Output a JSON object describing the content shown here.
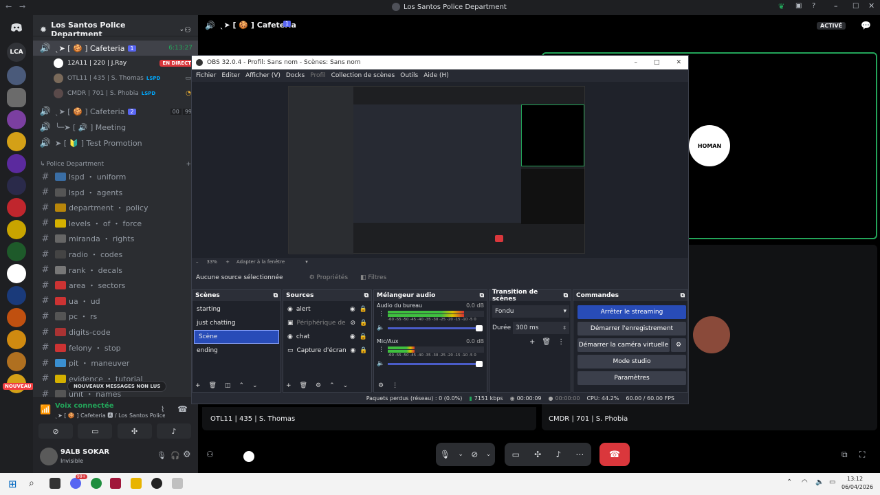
{
  "window": {
    "title": "Los Santos Police Department"
  },
  "server": {
    "name": "Los Santos Police Department"
  },
  "guild_label": "LCA",
  "guild_badge": "NOUVEAU",
  "voice_channels": [
    {
      "name": "ˎ➤ [ 🍪 ] Cafeteria",
      "badge": "1",
      "time": "6:13:27"
    },
    {
      "name": "ˎ➤ [ 🍪 ] Cafeteria",
      "badge": "2",
      "count_a": "00",
      "count_b": "99"
    },
    {
      "name": "╰─➤ [ 🔊 ] Meeting"
    },
    {
      "name": "➤ [ 🔰 ] Test Promotion"
    }
  ],
  "voice_members": [
    {
      "name": "12A11 | 220 | J.Ray",
      "tag": "EN DIRECT"
    },
    {
      "name": "OTL11 | 435 | S. Thomas",
      "tag": "LSPD"
    },
    {
      "name": "CMDR | 701 | S. Phobia",
      "tag": "LSPD"
    }
  ],
  "category": "Police Department",
  "text_channels": [
    "lspd ・ uniform",
    "lspd ・ agents",
    "department ・ policy",
    "levels ・ of ・ force",
    "miranda ・ rights",
    "radio ・ codes",
    "rank ・ decals",
    "area ・ sectors",
    "ua ・ ud",
    "pc ・ rs",
    "digits-code",
    "felony ・ stop",
    "pit ・ maneuver",
    "evidence ・ tutorial",
    "unit ・ names"
  ],
  "new_messages": "NOUVEAUX MESSAGES NON LUS",
  "voice_status": {
    "title": "Voix connectée",
    "subtitle": "ˎ➤ [ 🍪 ] Cafeteria 🅰 / Los Santos Police Depart..."
  },
  "user": {
    "name": "9ALB SOKAR",
    "status": "Invisible"
  },
  "call": {
    "channel": "ˎ➤ [ 🍪 ] Cafeteria",
    "badge": "1",
    "active": "ACTIVÉ",
    "tile_left": "OTL11 | 435 | S. Thomas",
    "tile_right": "CMDR | 701 | S. Phobia",
    "logo": "HOMAN"
  },
  "obs": {
    "title": "OBS 32.0.4 - Profil: Sans nom - Scènes: Sans nom",
    "menu": [
      "Fichier",
      "Editer",
      "Afficher (V)",
      "Docks",
      "Profil",
      "Collection de scènes",
      "Outils",
      "Aide (H)"
    ],
    "zoom": "33%",
    "fit": "Adapter à la fenêtre",
    "no_source": "Aucune source sélectionnée",
    "properties": "Propriétés",
    "filters": "Filtres",
    "scenes_header": "Scènes",
    "scenes": [
      "starting",
      "just chatting",
      "Scène",
      "ending"
    ],
    "sources_header": "Sources",
    "sources": [
      "alert",
      "Périphérique de c",
      "chat",
      "Capture d'écran"
    ],
    "mixer_header": "Mélangeur audio",
    "mixer": [
      {
        "name": "Audio du bureau",
        "db": "0.0 dB",
        "level": 0.85
      },
      {
        "name": "Mic/Aux",
        "db": "0.0 dB",
        "level": 0.3
      }
    ],
    "scale": "-60 -55 -50 -45 -40 -35 -30 -25 -20 -15 -10 -5 0",
    "transition_header": "Transition de scènes",
    "transition": "Fondu",
    "duration_label": "Durée",
    "duration": "300 ms",
    "commands_header": "Commandes",
    "commands": [
      "Arrêter le streaming",
      "Démarrer l'enregistrement",
      "Démarrer la caméra virtuelle",
      "Mode studio",
      "Paramètres"
    ],
    "status": {
      "dropped": "Paquets perdus (réseau) : 0 (0.0%)",
      "kbps": "7151 kbps",
      "stream_time": "00:00:09",
      "rec_time": "00:00:00",
      "cpu": "CPU: 44.2%",
      "fps": "60.00 / 60.00 FPS"
    }
  },
  "taskbar": {
    "time": "13:12",
    "date": "06/04/2026",
    "badge": "99+"
  }
}
